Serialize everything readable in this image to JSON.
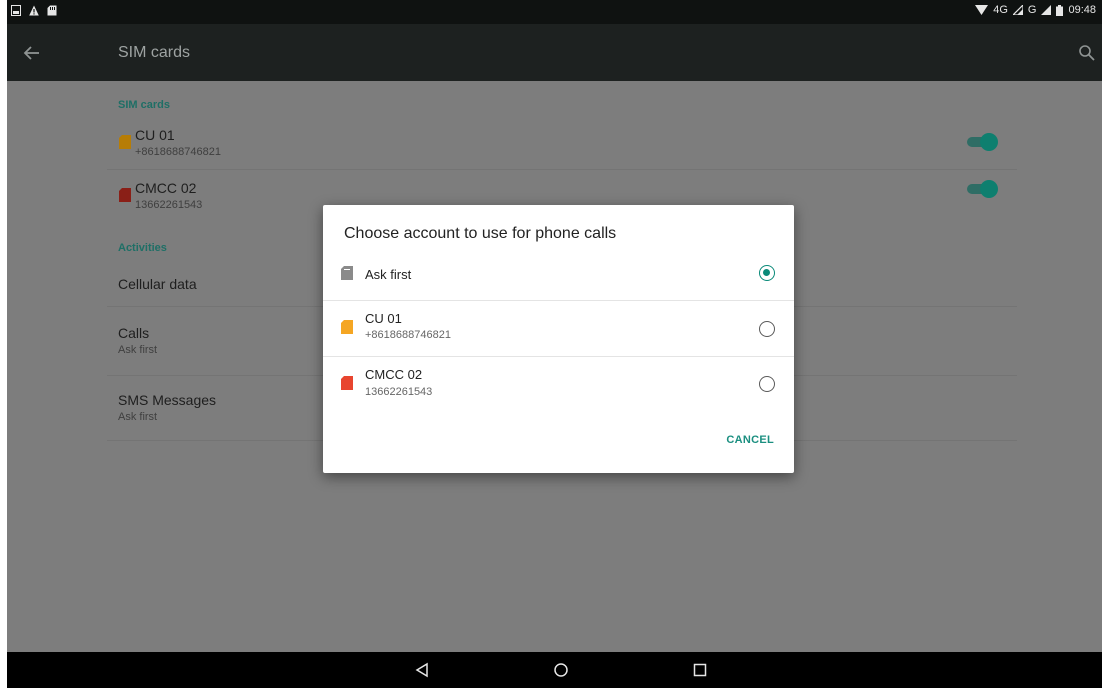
{
  "statusbar": {
    "network_label": "4G",
    "carrier_label": "G",
    "time": "09:48",
    "left_icons": [
      "sim-notification-icon",
      "warning-icon",
      "sd-card-icon"
    ]
  },
  "appbar": {
    "title": "SIM cards",
    "back_icon": "arrow-back-icon",
    "search_icon": "search-icon"
  },
  "sim_section": {
    "header": "SIM cards",
    "sims": [
      {
        "name": "CU 01",
        "number": "+8618688746821",
        "color": "#e0a000",
        "enabled": true
      },
      {
        "name": "CMCC 02",
        "number": "13662261543",
        "color": "#c02b1f",
        "enabled": true
      }
    ]
  },
  "activities_section": {
    "header": "Activities",
    "items": [
      {
        "title": "Cellular data",
        "subtitle": ""
      },
      {
        "title": "Calls",
        "subtitle": "Ask first"
      },
      {
        "title": "SMS Messages",
        "subtitle": "Ask first"
      }
    ]
  },
  "dialog": {
    "title": "Choose account to use for phone calls",
    "options": [
      {
        "title": "Ask first",
        "subtitle": "",
        "icon_color": "#8a8a8a",
        "selected": true
      },
      {
        "title": "CU 01",
        "subtitle": "+8618688746821",
        "icon_color": "#f5a623",
        "selected": false
      },
      {
        "title": "CMCC 02",
        "subtitle": "13662261543",
        "icon_color": "#e8452f",
        "selected": false
      }
    ],
    "cancel_label": "CANCEL",
    "accent_color": "#0a8a79"
  },
  "navbar": {
    "icons": [
      "back-triangle-icon",
      "home-circle-icon",
      "recents-square-icon"
    ]
  }
}
